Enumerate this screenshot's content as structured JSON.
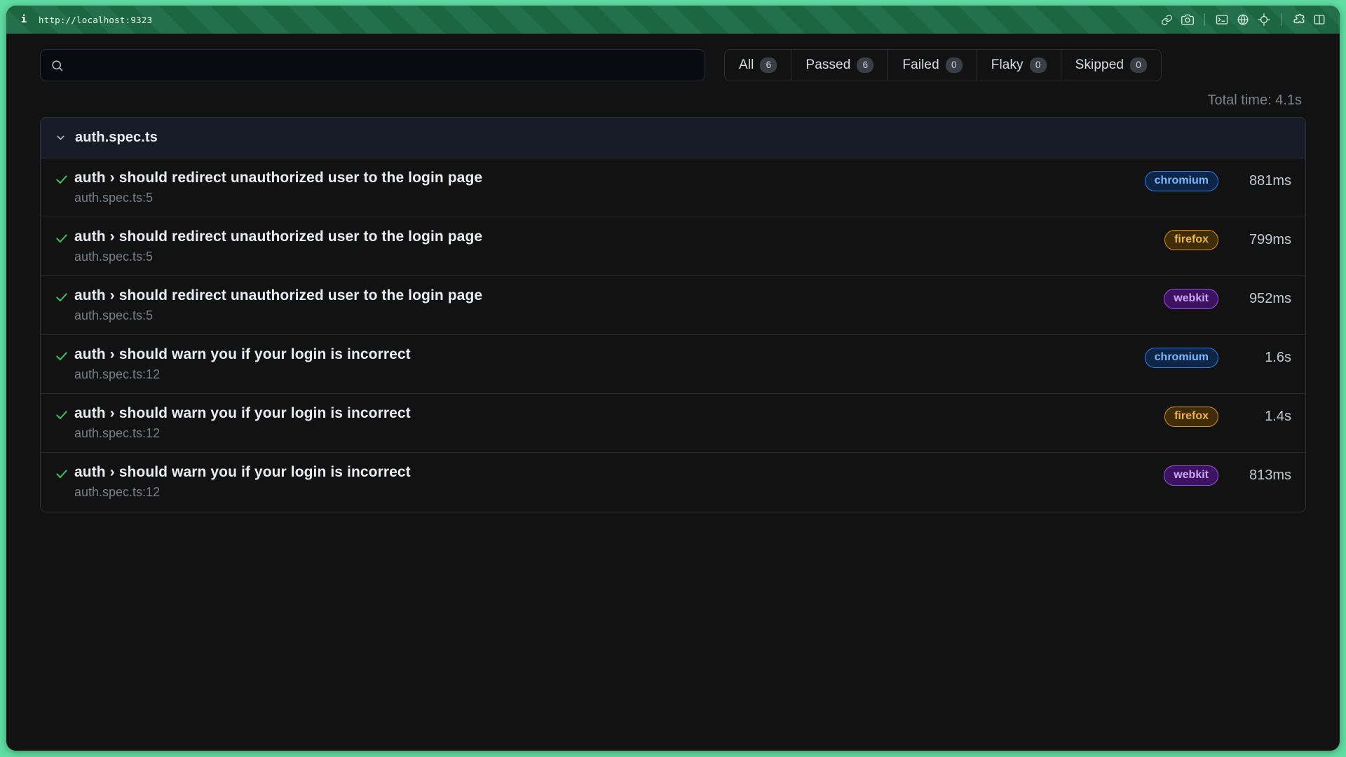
{
  "titlebar": {
    "info_glyph": "i",
    "url": "http://localhost:9323",
    "icons": [
      {
        "name": "link-icon",
        "title": "Copy link"
      },
      {
        "name": "camera-icon",
        "title": "Screenshot"
      },
      {
        "name": "terminal-icon",
        "title": "Console"
      },
      {
        "name": "globe-icon",
        "title": "Network"
      },
      {
        "name": "target-icon",
        "title": "Inspect element"
      },
      {
        "name": "puzzle-icon",
        "title": "Extensions"
      },
      {
        "name": "split-panel-icon",
        "title": "Toggle panel"
      }
    ]
  },
  "search": {
    "icon": "search-icon",
    "value": "",
    "placeholder": ""
  },
  "filters": {
    "tabs": [
      {
        "label": "All",
        "count": "6"
      },
      {
        "label": "Passed",
        "count": "6"
      },
      {
        "label": "Failed",
        "count": "0"
      },
      {
        "label": "Flaky",
        "count": "0"
      },
      {
        "label": "Skipped",
        "count": "0"
      }
    ]
  },
  "summary": {
    "total_time": "Total time: 4.1s"
  },
  "results": {
    "file": {
      "name": "auth.spec.ts",
      "expanded": true,
      "chevron": "chevron-down-icon"
    },
    "tests": [
      {
        "status": "passed",
        "status_icon": "check-icon",
        "suite": "auth",
        "separator": "›",
        "title": "should redirect unauthorized user to the login page",
        "full_title": "auth › should redirect unauthorized user to the login page",
        "location": "auth.spec.ts:5",
        "browser": "chromium",
        "duration": "881ms"
      },
      {
        "status": "passed",
        "status_icon": "check-icon",
        "suite": "auth",
        "separator": "›",
        "title": "should redirect unauthorized user to the login page",
        "full_title": "auth › should redirect unauthorized user to the login page",
        "location": "auth.spec.ts:5",
        "browser": "firefox",
        "duration": "799ms"
      },
      {
        "status": "passed",
        "status_icon": "check-icon",
        "suite": "auth",
        "separator": "›",
        "title": "should redirect unauthorized user to the login page",
        "full_title": "auth › should redirect unauthorized user to the login page",
        "location": "auth.spec.ts:5",
        "browser": "webkit",
        "duration": "952ms"
      },
      {
        "status": "passed",
        "status_icon": "check-icon",
        "suite": "auth",
        "separator": "›",
        "title": "should warn you if your login is incorrect",
        "full_title": "auth › should warn you if your login is incorrect",
        "location": "auth.spec.ts:12",
        "browser": "chromium",
        "duration": "1.6s"
      },
      {
        "status": "passed",
        "status_icon": "check-icon",
        "suite": "auth",
        "separator": "›",
        "title": "should warn you if your login is incorrect",
        "full_title": "auth › should warn you if your login is incorrect",
        "location": "auth.spec.ts:12",
        "browser": "firefox",
        "duration": "1.4s"
      },
      {
        "status": "passed",
        "status_icon": "check-icon",
        "suite": "auth",
        "separator": "›",
        "title": "should warn you if your login is incorrect",
        "full_title": "auth › should warn you if your login is incorrect",
        "location": "auth.spec.ts:12",
        "browser": "webkit",
        "duration": "813ms"
      }
    ]
  },
  "colors": {
    "frame_green": "#5fdda2",
    "titlebar_green": "#1d6b45",
    "page_bg": "#121212",
    "card_border": "#2b2f38",
    "file_header_bg": "#171c26",
    "pass_green": "#3fbf63",
    "chromium_text": "#79b8ff",
    "chromium_border": "#2f7be0",
    "firefox_text": "#eab64a",
    "firefox_border": "#cf9116",
    "webkit_text": "#cfa3f5",
    "webkit_border": "#9a4fe0"
  }
}
